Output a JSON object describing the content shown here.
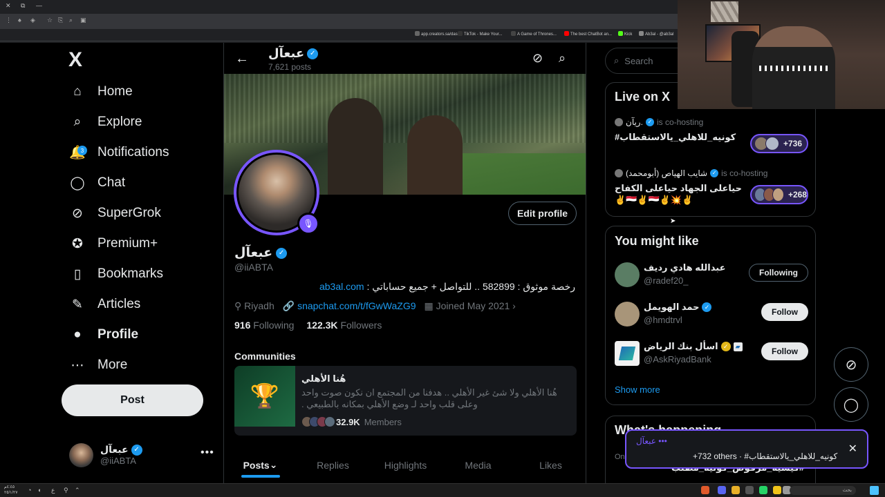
{
  "browser": {
    "bookmarks": [
      {
        "label": "app.creators.sa/das...",
        "color": "#666666"
      },
      {
        "label": "TikTok - Make Your...",
        "color": "#333333"
      },
      {
        "label": "A Game of Thrones...",
        "color": "#444444"
      },
      {
        "label": "The best ChatBot an...",
        "color": "#ff0000"
      },
      {
        "label": "Kick",
        "color": "#53fc18"
      },
      {
        "label": "Ab3al - @ab3al",
        "color": "#888888"
      }
    ]
  },
  "nav": {
    "logo": "X",
    "items": [
      {
        "key": "home",
        "label": "Home",
        "icon": "home-icon",
        "glyph": "⌂"
      },
      {
        "key": "explore",
        "label": "Explore",
        "icon": "search-icon",
        "glyph": "⌕"
      },
      {
        "key": "notifications",
        "label": "Notifications",
        "icon": "bell-icon",
        "glyph": "🔔"
      },
      {
        "key": "chat",
        "label": "Chat",
        "icon": "chat-bubble-icon",
        "glyph": "◯"
      },
      {
        "key": "supergrok",
        "label": "SuperGrok",
        "icon": "grok-icon",
        "glyph": "⊘"
      },
      {
        "key": "premium",
        "label": "Premium+",
        "icon": "premium-badge-icon",
        "glyph": "✪"
      },
      {
        "key": "bookmarks",
        "label": "Bookmarks",
        "icon": "bookmark-icon",
        "glyph": "▯"
      },
      {
        "key": "articles",
        "label": "Articles",
        "icon": "article-icon",
        "glyph": "✎"
      },
      {
        "key": "profile",
        "label": "Profile",
        "icon": "person-icon",
        "glyph": "●"
      },
      {
        "key": "more",
        "label": "More",
        "icon": "more-circle-icon",
        "glyph": "⋯"
      }
    ],
    "notifications_badge": "3",
    "post_label": "Post",
    "account": {
      "name": "عبعآل",
      "handle": "@iiABTA"
    }
  },
  "header": {
    "name": "عبعآل",
    "posts": "7,621 posts"
  },
  "profile": {
    "name": "عبعآل",
    "handle": "@iiABTA",
    "edit_label": "Edit profile",
    "bio_text": "رخصة موثوق : 582899 .. للتواصل + جميع حساباتي : ",
    "bio_link": "ab3al.com",
    "location": "Riyadh",
    "link": "snapchat.com/t/fGwWaZG9",
    "joined": "Joined May 2021",
    "following_count": "916",
    "following_label": "Following",
    "followers_count": "122.3K",
    "followers_label": "Followers"
  },
  "communities": {
    "title": "Communities",
    "name": "هُنا الأهلي",
    "description": "هُنا الأهلي ولا شئ غير الأهلي .. هدفنا من المجتمع ان نكون صوت واحد وعلى قلب واحد لـ وضع الأهلي بمكانه بالطبيعي .",
    "members_count": "32.9K",
    "members_label": "Members"
  },
  "tabs": [
    {
      "label": "Posts",
      "active": true
    },
    {
      "label": "Replies",
      "active": false
    },
    {
      "label": "Highlights",
      "active": false
    },
    {
      "label": "Media",
      "active": false
    },
    {
      "label": "Likes",
      "active": false
    }
  ],
  "search": {
    "placeholder": "Search"
  },
  "live": {
    "title": "Live on X",
    "items": [
      {
        "host": ".ريآن",
        "status": "is co-hosting",
        "title": "كونيه_للاهلي_يالاستقطاب#",
        "count": "+736"
      },
      {
        "host": "شايب الهياص (أبومحمد)",
        "status": "is co-hosting",
        "title": "حياعلى الجهاد حياعلى الكفاح ✌️💥✌️🇾🇪✌️🇾🇪✌️",
        "count": "+268"
      }
    ]
  },
  "who_to_follow": {
    "title": "You might like",
    "users": [
      {
        "name": "عبدالله هادي رديف",
        "handle": "@radef20_",
        "verified": false,
        "button": "Following",
        "color": "#5a7d64"
      },
      {
        "name": "حمد الهويمل",
        "handle": "@hmdtrvl",
        "verified": true,
        "button": "Follow",
        "color": "#a89579"
      },
      {
        "name": "اسأل بنك الرياض",
        "handle": "@AskRiyadBank",
        "verified": true,
        "gold": true,
        "button": "Follow",
        "color": "#f2f2f2"
      }
    ],
    "show_more": "Show more"
  },
  "whats_happening": {
    "title": "What's happening",
    "trend_sub": "On",
    "trend_title": "#كيشيه_مرفوض_كونيه_مطلب"
  },
  "toast": {
    "host": "••• عبعآل",
    "text": "+732 others · #كونيه_للاهلي_يالاستقطاب"
  },
  "taskbar": {
    "clock": "٤:٤٥م\n٢٥/١/٢٧",
    "search": "بحث"
  }
}
